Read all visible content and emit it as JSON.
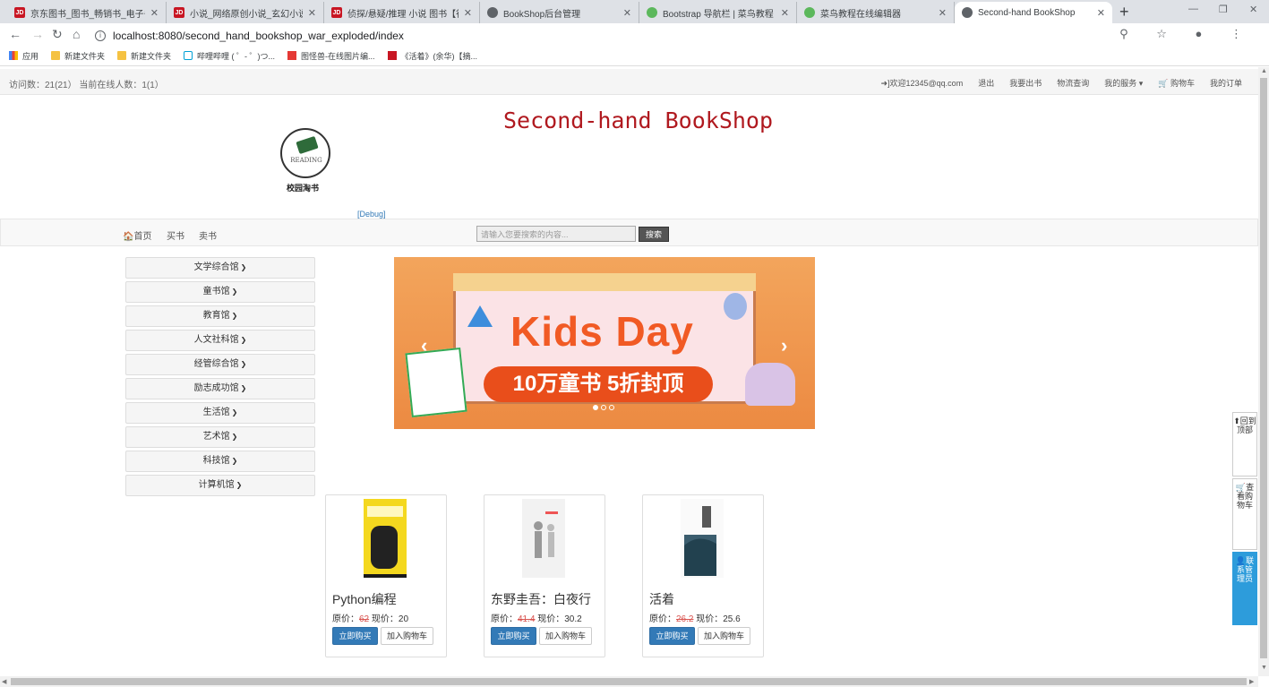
{
  "browser": {
    "tabs": [
      {
        "favicon": "jd-icon",
        "title": "京东图书_图书_畅销书_电子书_新",
        "active": false
      },
      {
        "favicon": "jd-icon",
        "title": "小说_网络原创小说_玄幻小说-图",
        "active": false
      },
      {
        "favicon": "jd-icon",
        "title": "侦探/悬疑/推理 小说 图书【行情",
        "active": false
      },
      {
        "favicon": "globe-icon",
        "title": "BookShop后台管理",
        "active": false
      },
      {
        "favicon": "runoob-icon",
        "title": "Bootstrap 导航栏 | 菜鸟教程",
        "active": false
      },
      {
        "favicon": "runoob-icon",
        "title": "菜鸟教程在线编辑器",
        "active": false
      },
      {
        "favicon": "globe-icon",
        "title": "Second-hand BookShop",
        "active": true
      }
    ],
    "new_tab": "+",
    "window_controls": {
      "minimize": "—",
      "restore": "❐",
      "close": "✕"
    },
    "nav": {
      "back": "←",
      "forward": "→",
      "reload": "↻",
      "home": "⌂"
    },
    "url": "localhost:8080/second_hand_bookshop_war_exploded/index",
    "url_icons": "⚲ ☆ ● ⋮",
    "bookmarks": [
      {
        "icon": "apps-icon",
        "label": "应用"
      },
      {
        "icon": "folder-icon",
        "label": "新建文件夹"
      },
      {
        "icon": "folder-icon",
        "label": "新建文件夹"
      },
      {
        "icon": "bilibili-icon",
        "label": "哔哩哔哩 ( ゜- ゜)つ..."
      },
      {
        "icon": "image-icon",
        "label": "图怪兽-在线图片编..."
      },
      {
        "icon": "jd-icon",
        "label": "《活着》(余华)【摘..."
      }
    ]
  },
  "topbar": {
    "visits": "访问数：21(21） 当前在线人数：1(1）",
    "welcome": "➜]欢迎12345@qq.com",
    "logout": "退出",
    "sell": "我要出书",
    "logistics": "物流查询",
    "services": "我的服务 ▾",
    "cart": "🛒 购物车",
    "orders": "我的订单"
  },
  "header": {
    "title": "Second-hand BookShop",
    "logo_text": "READING",
    "logo_caption": "校园淘书",
    "debug": "[Debug]"
  },
  "navbar": {
    "home": "🏠首页",
    "buy": "买书",
    "sell": "卖书",
    "search_placeholder": "请输入您要搜索的内容...",
    "search_button": "搜索"
  },
  "categories": [
    "文学综合馆",
    "童书馆",
    "教育馆",
    "人文社科馆",
    "经管综合馆",
    "励志成功馆",
    "生活馆",
    "艺术馆",
    "科技馆",
    "计算机馆"
  ],
  "carousel": {
    "headline": "Kids Day",
    "subline": "10万童书 5折封顶",
    "prev": "‹",
    "next": "›",
    "slides": 3,
    "active_slide": 1
  },
  "products": [
    {
      "name": "Python编程",
      "orig_label": "原价：",
      "orig": "62",
      "now_label": " 现价：",
      "now": "20",
      "buy": "立即购买",
      "cart": "加入购物车"
    },
    {
      "name": "东野圭吾：白夜行",
      "orig_label": "原价：",
      "orig": "41.4",
      "now_label": " 现价：",
      "now": "30.2",
      "buy": "立即购买",
      "cart": "加入购物车"
    },
    {
      "name": "活着",
      "orig_label": "原价：",
      "orig": "26.2",
      "now_label": " 现价：",
      "now": "25.6",
      "buy": "立即购买",
      "cart": "加入购物车"
    }
  ],
  "float_panel": {
    "top": "⬆回到顶部",
    "cart": "🛒查看购物车",
    "admin": "👤联系管理员"
  },
  "colors": {
    "title_red": "#b0191f",
    "primary_blue": "#337ab7",
    "float_blue": "#2d9cdb",
    "strike_red": "#d9534f"
  }
}
